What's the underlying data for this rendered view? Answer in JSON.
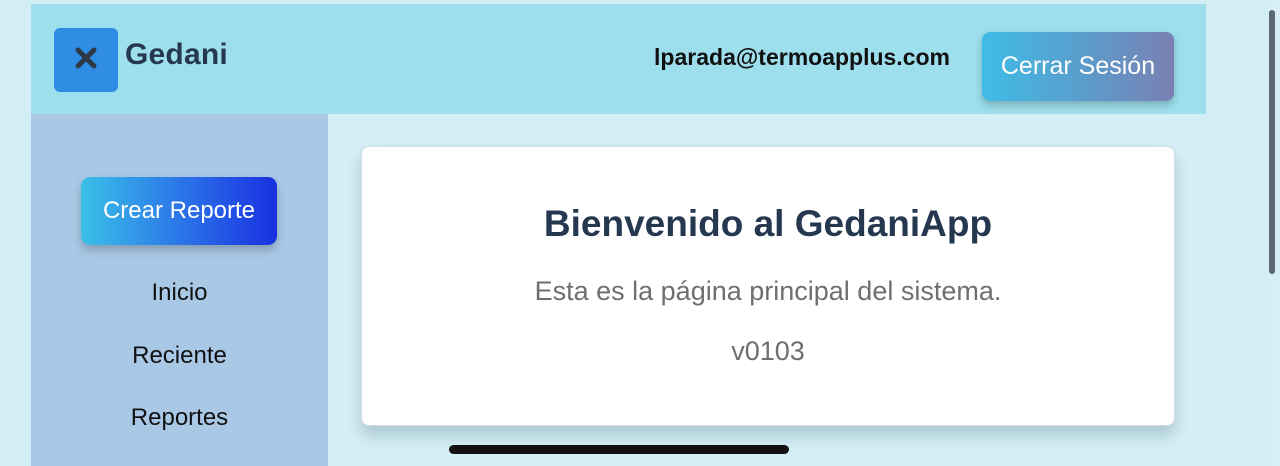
{
  "header": {
    "brand": "Gedani",
    "user_email": "lparada@termoapplus.com",
    "logout_label": "Cerrar Sesión",
    "logo_icon": "close-icon"
  },
  "sidebar": {
    "create_label": "Crear Reporte",
    "items": [
      {
        "label": "Inicio"
      },
      {
        "label": "Reciente"
      },
      {
        "label": "Reportes"
      }
    ]
  },
  "main": {
    "title": "Bienvenido al GedaniApp",
    "subtitle": "Esta es la página principal del sistema.",
    "version": "v0103"
  },
  "colors": {
    "header_bg": "#9ddfed",
    "sidebar_bg": "#a9c8e6",
    "logo_bg": "#2f8de4",
    "title_text": "#25384f"
  }
}
